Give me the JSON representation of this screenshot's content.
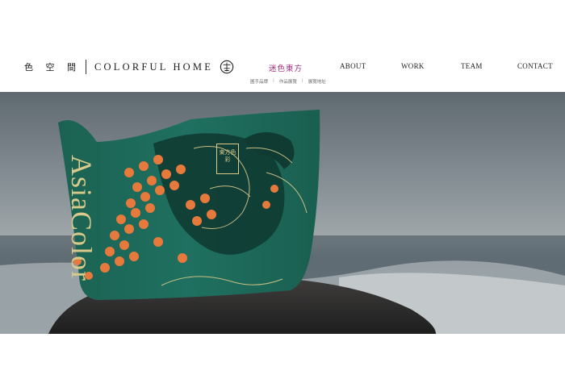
{
  "brand": {
    "name_cn": "色 空 間",
    "name_en": "COLORFUL HOME",
    "logo_icon": "brand-seal-icon"
  },
  "nav": {
    "active_label": "迷色東方",
    "items": [
      "ABOUT",
      "WORK",
      "TEAM",
      "CONTACT"
    ]
  },
  "subnav": {
    "items": [
      "圖手品牌",
      "作品展覽",
      "展覽地址"
    ],
    "separator": "|"
  },
  "hero": {
    "bag_text": "AsiaColor",
    "seal_text": "東方色彩",
    "colors": {
      "bag_green": "#1e6b5a",
      "accent_orange": "#e57a3c",
      "gold": "#d9c98a",
      "sea_sky": "#7f8a92"
    }
  }
}
